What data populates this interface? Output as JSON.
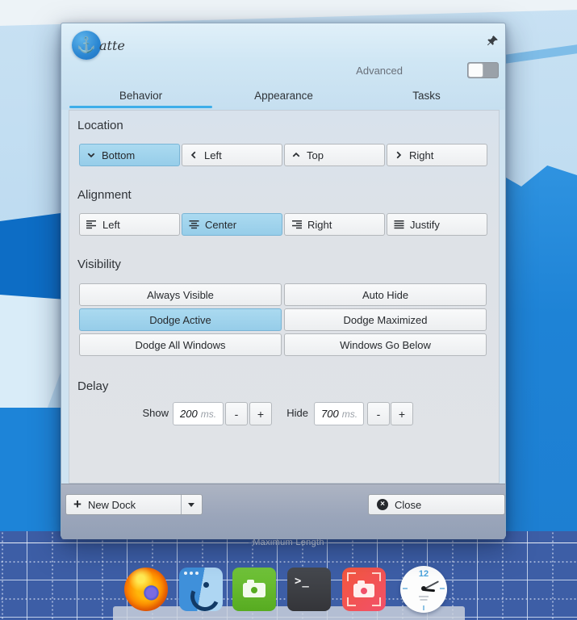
{
  "window": {
    "title": "atte",
    "advanced_label": "Advanced",
    "advanced_on": false,
    "accent_color": "#3daee9",
    "selected_color": "#9fd3eb"
  },
  "tabs": [
    {
      "label": "Behavior",
      "active": true
    },
    {
      "label": "Appearance",
      "active": false
    },
    {
      "label": "Tasks",
      "active": false
    }
  ],
  "behavior": {
    "location": {
      "title": "Location",
      "options": [
        {
          "label": "Bottom",
          "icon": "chevron-down",
          "selected": true
        },
        {
          "label": "Left",
          "icon": "chevron-left",
          "selected": false
        },
        {
          "label": "Top",
          "icon": "chevron-up",
          "selected": false
        },
        {
          "label": "Right",
          "icon": "chevron-right",
          "selected": false
        }
      ]
    },
    "alignment": {
      "title": "Alignment",
      "options": [
        {
          "label": "Left",
          "icon": "align-left",
          "selected": false
        },
        {
          "label": "Center",
          "icon": "align-center",
          "selected": true
        },
        {
          "label": "Right",
          "icon": "align-right",
          "selected": false
        },
        {
          "label": "Justify",
          "icon": "align-justify",
          "selected": false
        }
      ]
    },
    "visibility": {
      "title": "Visibility",
      "options": [
        {
          "label": "Always Visible",
          "selected": false
        },
        {
          "label": "Auto Hide",
          "selected": false
        },
        {
          "label": "Dodge Active",
          "selected": true
        },
        {
          "label": "Dodge Maximized",
          "selected": false
        },
        {
          "label": "Dodge All Windows",
          "selected": false
        },
        {
          "label": "Windows Go Below",
          "selected": false
        }
      ]
    },
    "delay": {
      "title": "Delay",
      "show_label": "Show",
      "show_value": "200",
      "hide_label": "Hide",
      "hide_value": "700",
      "unit": "ms.",
      "minus_label": "-",
      "plus_label": "+"
    }
  },
  "footer": {
    "new_dock_label": "New Dock",
    "close_label": "Close"
  },
  "desktop": {
    "max_length_label": "Maximum Length",
    "dock_icons": [
      "firefox",
      "file-manager",
      "camera-green",
      "terminal",
      "screenshot",
      "clock"
    ],
    "terminal_glyph": ">_",
    "clock_hour_label": "12"
  }
}
